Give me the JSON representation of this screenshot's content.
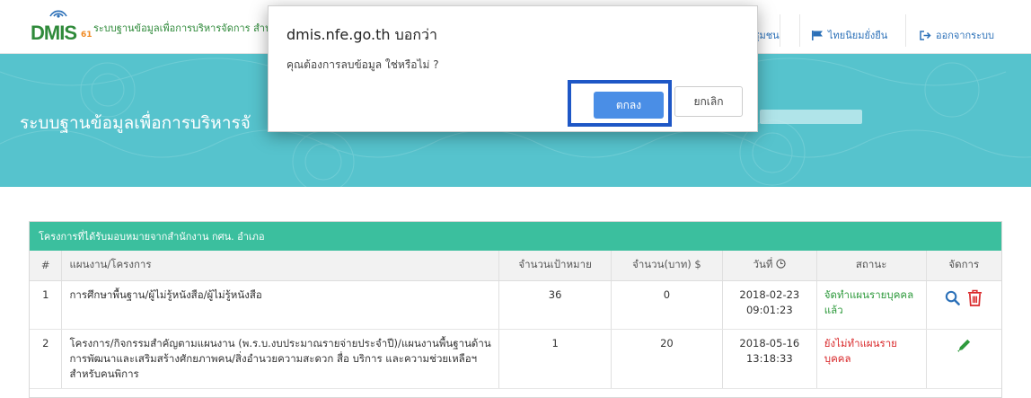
{
  "header": {
    "logo_text": "DMIS",
    "logo_suffix": "61",
    "app_title": "ระบบฐานข้อมูลเพื่อการบริหารจัดการ สำนัก",
    "nav": [
      {
        "label": "ชุมชน",
        "icon": "community-icon"
      },
      {
        "label": "ไทยนิยมยั่งยืน",
        "icon": "flag-icon"
      },
      {
        "label": "ออกจากระบบ",
        "icon": "logout-icon"
      }
    ]
  },
  "hero": {
    "title": "ระบบฐานข้อมูลเพื่อการบริหารจั"
  },
  "dialog": {
    "title": "dmis.nfe.go.th บอกว่า",
    "message": "คุณต้องการลบข้อมูล ใช่หรือไม่ ?",
    "ok_label": "ตกลง",
    "cancel_label": "ยกเลิก"
  },
  "table": {
    "caption": "โครงการที่ได้รับมอบหมายจากสำนักงาน กศน. อำเภอ",
    "headers": [
      "#",
      "แผนงาน/โครงการ",
      "จำนวนเป้าหมาย",
      "จำนวน(บาท) $",
      "วันที่",
      "สถานะ",
      "จัดการ"
    ],
    "rows": [
      {
        "num": "1",
        "project": "การศึกษาพื้นฐาน/ผู้ไม่รู้หนังสือ/ผู้ไม่รู้หนังสือ",
        "target": "36",
        "amount": "0",
        "date": "2018-02-23",
        "time": "09:01:23",
        "status": "จัดทำแผนรายบุคคล แล้ว",
        "status_type": "done",
        "actions": [
          "search-icon",
          "trash-icon"
        ]
      },
      {
        "num": "2",
        "project": "โครงการ/กิจกรรมสำคัญตามแผนงาน (พ.ร.บ.งบประมาณรายจ่ายประจำปี)/แผนงานพื้นฐานด้านการพัฒนาและเสริมสร้างศักยภาพคน/สิ่งอำนวยความสะดวก สื่อ บริการ และความช่วยเหลือฯ สำหรับคนพิการ",
        "target": "1",
        "amount": "20",
        "date": "2018-05-16",
        "time": "13:18:33",
        "status": "ยังไม่ทำแผนรายบุคคล",
        "status_type": "todo",
        "actions": [
          "pencil-icon"
        ]
      }
    ]
  },
  "colors": {
    "brand_green": "#2f8a3a",
    "hero_teal": "#56c3cd",
    "table_head": "#3bbf9e",
    "primary_button": "#4a8ee6",
    "highlight_border": "#1e57c6",
    "status_done": "#2e9a3c",
    "status_todo": "#d9292b"
  }
}
